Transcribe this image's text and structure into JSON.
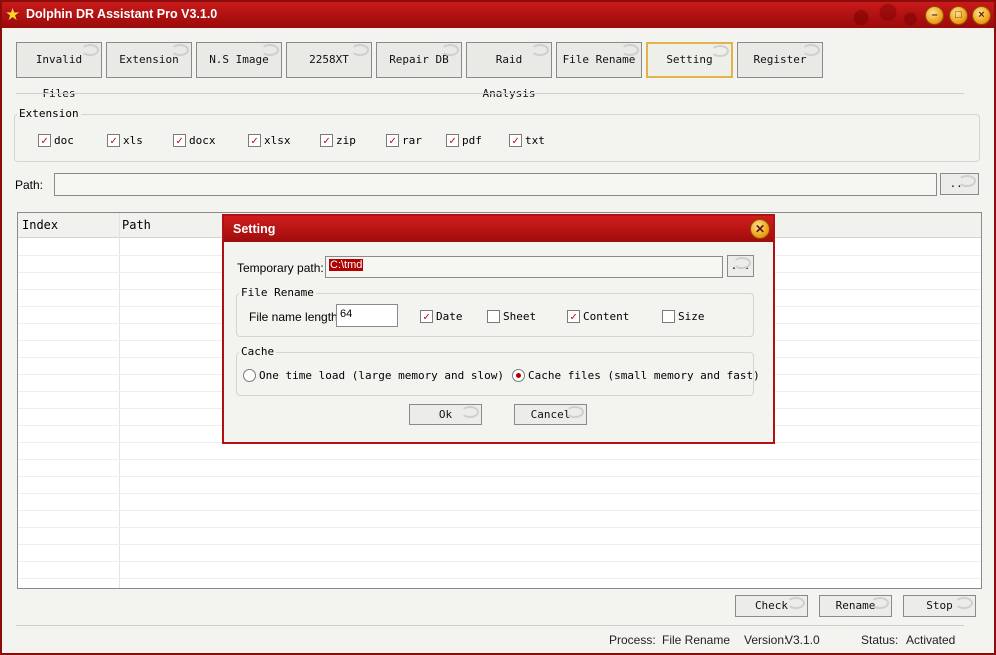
{
  "window": {
    "title": "Dolphin DR Assistant Pro V3.1.0",
    "accent": "#b01212"
  },
  "tabs": [
    {
      "label": "Invalid Files"
    },
    {
      "label": "Extension"
    },
    {
      "label": "N.S Image"
    },
    {
      "label": "2258XT"
    },
    {
      "label": "Repair DB"
    },
    {
      "label": "Raid Analysis"
    },
    {
      "label": "File Rename"
    },
    {
      "label": "Setting"
    },
    {
      "label": "Register"
    }
  ],
  "active_tab": "Setting",
  "extension_group": {
    "title": "Extension",
    "items": [
      {
        "label": "doc",
        "checked": true,
        "mark": "✓"
      },
      {
        "label": "xls",
        "checked": true,
        "mark": "✓"
      },
      {
        "label": "docx",
        "checked": true,
        "mark": "✓"
      },
      {
        "label": "xlsx",
        "checked": true,
        "mark": "✓"
      },
      {
        "label": "zip",
        "checked": true,
        "mark": "✓"
      },
      {
        "label": "rar",
        "checked": true,
        "mark": "✓"
      },
      {
        "label": "pdf",
        "checked": true,
        "mark": "✓"
      },
      {
        "label": "txt",
        "checked": true,
        "mark": "✓"
      }
    ]
  },
  "path": {
    "label": "Path:",
    "value": "",
    "browse_label": "..."
  },
  "table": {
    "columns": [
      "Index",
      "Path"
    ],
    "rows": []
  },
  "buttons": {
    "check": "Check",
    "rename": "Rename",
    "stop": "Stop"
  },
  "status": {
    "process_label": "Process:",
    "process_value": "File Rename",
    "version_label": "Version:",
    "version_value": "V3.1.0",
    "status_label": "Status:",
    "status_value": "Activated"
  },
  "dialog": {
    "title": "Setting",
    "close_glyph": "✕",
    "temp_path_label": "Temporary path:",
    "temp_path_value": "C:\\tmd",
    "browse_label": "...",
    "file_rename": {
      "title": "File Rename",
      "length_label": "File name length:",
      "length_value": "64",
      "options": [
        {
          "label": "Date",
          "checked": true,
          "mark": "✓"
        },
        {
          "label": "Sheet",
          "checked": false,
          "mark": ""
        },
        {
          "label": "Content",
          "checked": true,
          "mark": "✓"
        },
        {
          "label": "Size",
          "checked": false,
          "mark": ""
        }
      ]
    },
    "cache": {
      "title": "Cache",
      "options": [
        {
          "label": "One time load (large memory and slow)",
          "selected": false
        },
        {
          "label": "Cache files (small memory and fast)",
          "selected": true
        }
      ]
    },
    "ok_label": "Ok",
    "cancel_label": "Cancel"
  }
}
